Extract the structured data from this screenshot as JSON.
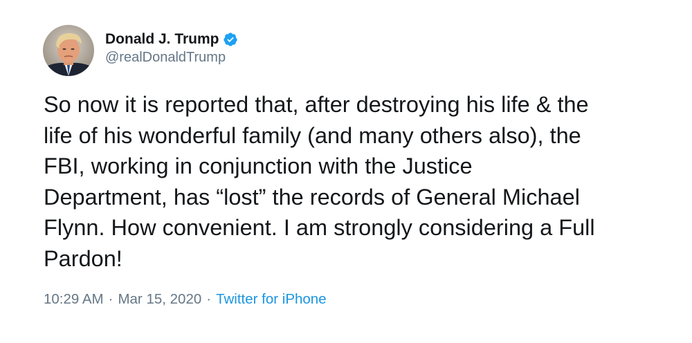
{
  "author": {
    "display_name": "Donald J. Trump",
    "handle": "@realDonaldTrump",
    "verified": true,
    "avatar_icon": "profile-photo"
  },
  "tweet": {
    "text": "So now it is reported that, after destroying his life & the\nlife of his wonderful family (and many others also), the\nFBI, working in conjunction with the Justice\nDepartment, has “lost” the records of General Michael\nFlynn. How convenient. I am strongly considering a Full\nPardon!",
    "time": "10:29 AM",
    "separator": "·",
    "date": "Mar 15, 2020",
    "source": "Twitter for iPhone"
  },
  "colors": {
    "text": "#14171a",
    "muted": "#657786",
    "link": "#1b95e0",
    "verified_badge": "#1da1f2"
  }
}
